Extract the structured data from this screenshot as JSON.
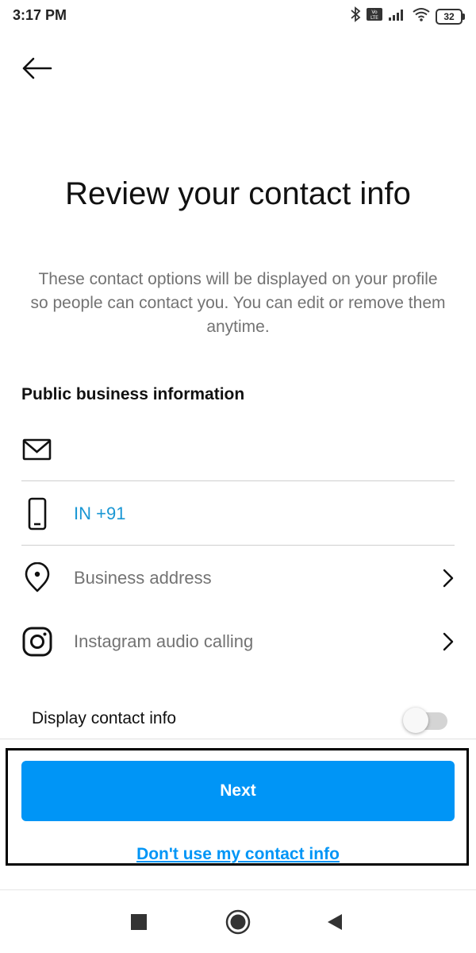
{
  "status_bar": {
    "time": "3:17 PM",
    "battery": "32",
    "network_badge": "Vo LTE"
  },
  "header": {
    "back_icon": "arrow-left-icon"
  },
  "page": {
    "title": "Review your contact info",
    "subtitle": "These contact options will be displayed on your profile so people can contact you. You can edit or remove them anytime."
  },
  "section": {
    "title": "Public business information"
  },
  "fields": {
    "email": {
      "icon": "envelope-icon",
      "value": ""
    },
    "phone": {
      "icon": "phone-icon",
      "value": "IN +91"
    },
    "address": {
      "icon": "location-pin-icon",
      "label": "Business address"
    },
    "audio_calling": {
      "icon": "instagram-icon",
      "label": "Instagram audio calling"
    }
  },
  "toggle": {
    "label": "Display contact info",
    "on": false
  },
  "actions": {
    "next_label": "Next",
    "skip_label": "Don't use my contact info"
  },
  "colors": {
    "accent": "#0095f6",
    "link_blue": "#1a97d4",
    "muted_text": "#737373"
  },
  "nav_bar": {
    "recents_icon": "square-icon",
    "home_icon": "circle-home-icon",
    "back_icon": "triangle-back-icon"
  }
}
